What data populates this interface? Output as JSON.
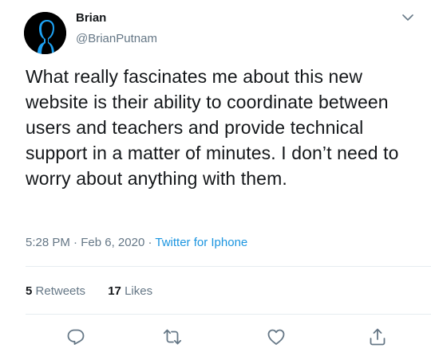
{
  "user": {
    "name": "Brian",
    "handle": "@BrianPutnam",
    "avatar_icon": "user-silhouette-icon"
  },
  "tweet": {
    "text": "What really fascinates me about this new website is their ability to coordinate between users and teachers and provide technical support in a matter of minutes. I don’t need to worry about anything with them.",
    "time": "5:28 PM",
    "date": "Feb 6, 2020",
    "source": "Twitter for Iphone",
    "separator": "·"
  },
  "stats": {
    "retweets_count": "5",
    "retweets_label": "Retweets",
    "likes_count": "17",
    "likes_label": "Likes"
  },
  "icons": {
    "menu": "chevron-down-icon",
    "reply": "reply-icon",
    "retweet": "retweet-icon",
    "like": "heart-icon",
    "share": "share-icon"
  },
  "colors": {
    "text": "#14171a",
    "secondary": "#657786",
    "link": "#1b95e0",
    "divider": "#e6ecf0",
    "avatar_bg": "#000000",
    "avatar_accent": "#1da1f2"
  }
}
